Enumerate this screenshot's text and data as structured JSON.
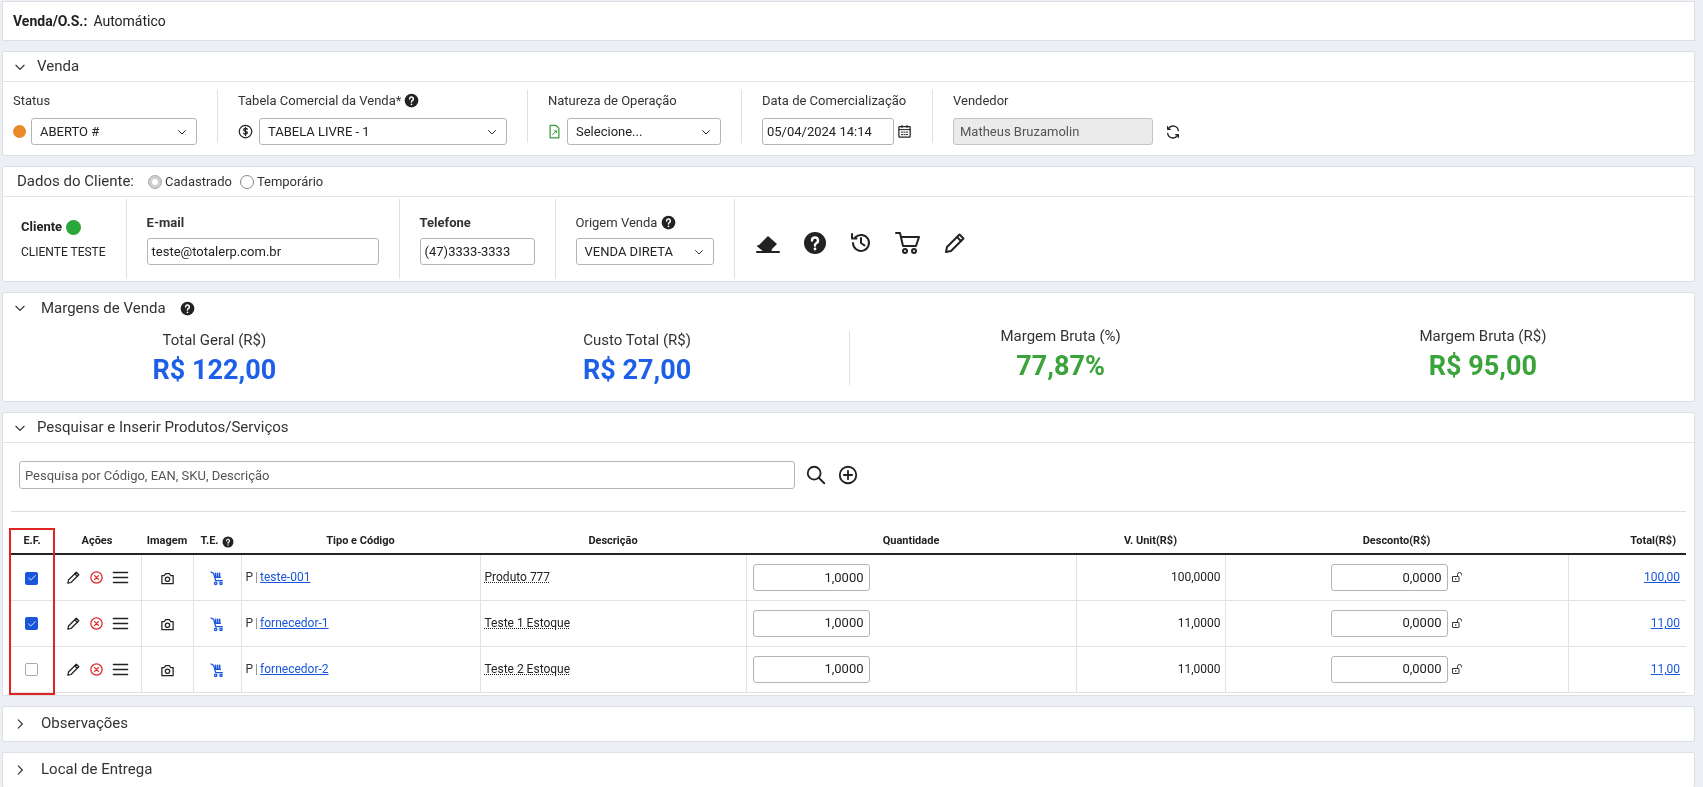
{
  "header": {
    "label": "Venda/O.S.:",
    "value": "Automático"
  },
  "venda": {
    "title": "Venda",
    "expanded": true,
    "status": {
      "label": "Status",
      "color": "#e8892a",
      "value": "ABERTO #"
    },
    "tabela": {
      "label": "Tabela Comercial da Venda*",
      "value": "TABELA LIVRE - 1"
    },
    "natureza": {
      "label": "Natureza de Operação",
      "value": "Selecione..."
    },
    "data": {
      "label": "Data de Comercialização",
      "value": "05/04/2024 14:14"
    },
    "vendedor": {
      "label": "Vendedor",
      "value": "Matheus Bruzamolin"
    }
  },
  "cliente": {
    "title": "Dados do Cliente:",
    "options": [
      {
        "label": "Cadastrado",
        "selected": true
      },
      {
        "label": "Temporário",
        "selected": false
      }
    ],
    "cliente": {
      "label": "Cliente",
      "color": "#2aa63a",
      "name": "CLIENTE TESTE"
    },
    "email": {
      "label": "E-mail",
      "value": "teste@totalerp.com.br"
    },
    "telefone": {
      "label": "Telefone",
      "value": "(47)3333-3333"
    },
    "origem": {
      "label": "Origem Venda",
      "value": "VENDA DIRETA"
    }
  },
  "margens": {
    "title": "Margens de Venda",
    "expanded": true,
    "metrics": [
      {
        "label": "Total Geral (R$)",
        "value": "R$ 122,00",
        "color": "#1d5fe6"
      },
      {
        "label": "Custo Total (R$)",
        "value": "R$ 27,00",
        "color": "#1d5fe6"
      },
      {
        "label": "Margem Bruta (%)",
        "value": "77,87%",
        "color": "#3aa33a"
      },
      {
        "label": "Margem Bruta (R$)",
        "value": "R$ 95,00",
        "color": "#3aa33a"
      }
    ]
  },
  "produtos": {
    "title": "Pesquisar e Inserir Produtos/Serviços",
    "expanded": true,
    "search": {
      "placeholder": "Pesquisa por Código, EAN, SKU, Descrição"
    },
    "columns": [
      "E.F.",
      "Ações",
      "Imagem",
      "T.E.",
      "Tipo e Código",
      "Descrição",
      "Quantidade",
      "V. Unit(R$)",
      "Desconto(R$)",
      "Total(R$)"
    ],
    "rows": [
      {
        "checked": true,
        "tipo": "P",
        "codigo": "teste-001",
        "descricao": "Produto 777",
        "quantidade": "1,0000",
        "unitario": "100,0000",
        "desconto": "0,0000",
        "total": "100,00"
      },
      {
        "checked": true,
        "tipo": "P",
        "codigo": "fornecedor-1",
        "descricao": "Teste 1 Estoque",
        "quantidade": "1,0000",
        "unitario": "11,0000",
        "desconto": "0,0000",
        "total": "11,00"
      },
      {
        "checked": false,
        "tipo": "P",
        "codigo": "fornecedor-2",
        "descricao": "Teste 2 Estoque",
        "quantidade": "1,0000",
        "unitario": "11,0000",
        "desconto": "0,0000",
        "total": "11,00"
      }
    ]
  },
  "secoes": [
    {
      "title": "Observações",
      "expanded": false
    },
    {
      "title": "Local de Entrega",
      "expanded": false
    }
  ]
}
